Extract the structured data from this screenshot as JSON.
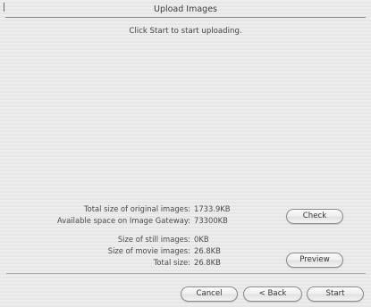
{
  "window": {
    "title": "Upload Images"
  },
  "instruction": "Click Start to start uploading.",
  "info": {
    "total_original_label": "Total size of original images:",
    "total_original_value": "1733.9KB",
    "available_space_label": "Available space on Image Gateway:",
    "available_space_value": "73300KB",
    "still_size_label": "Size of still images:",
    "still_size_value": "0KB",
    "movie_size_label": "Size of movie images:",
    "movie_size_value": "26.8KB",
    "total_size_label": "Total size:",
    "total_size_value": "26.8KB"
  },
  "buttons": {
    "check": "Check",
    "preview": "Preview",
    "cancel": "Cancel",
    "back": "< Back",
    "start": "Start"
  }
}
